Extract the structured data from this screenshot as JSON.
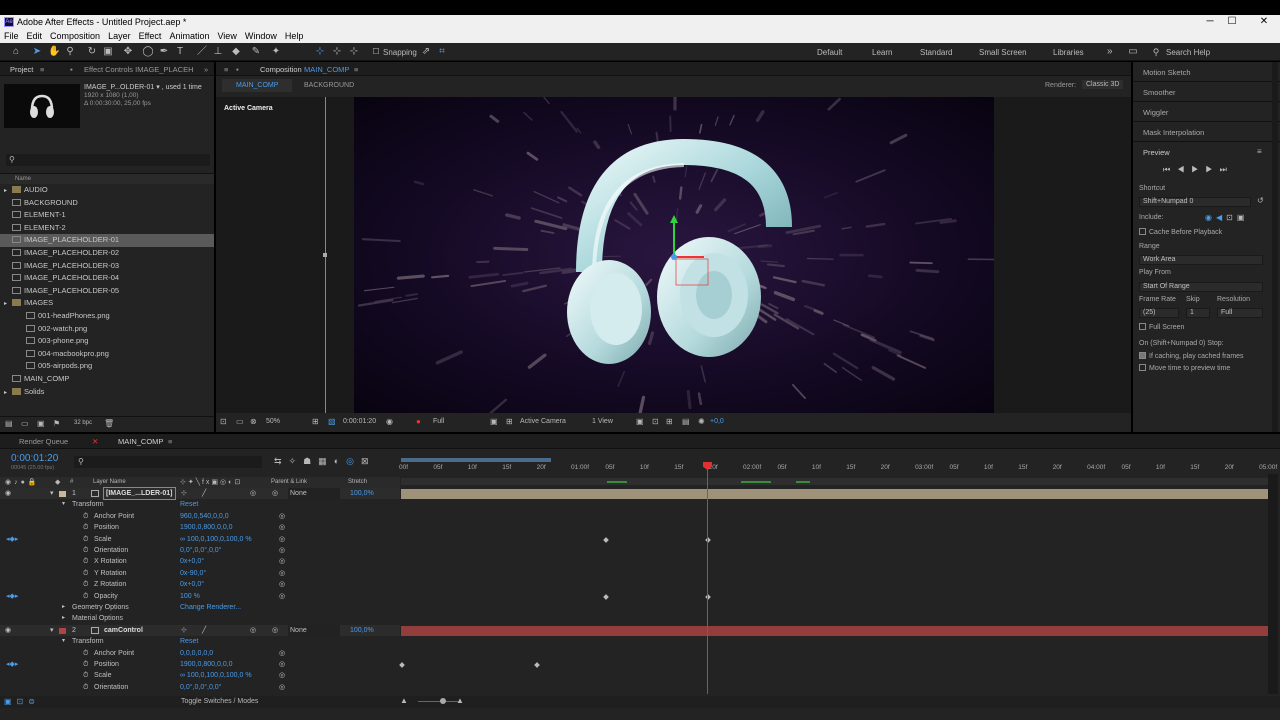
{
  "window": {
    "title": "Adobe After Effects - Untitled Project.aep *",
    "logo_text": "Ae",
    "controls": [
      "─",
      "☐",
      "✕"
    ]
  },
  "menu": [
    "File",
    "Edit",
    "Composition",
    "Layer",
    "Effect",
    "Animation",
    "View",
    "Window",
    "Help"
  ],
  "toolbar": {
    "snapping": "Snapping",
    "workspaces": [
      "Default",
      "Learn",
      "Standard",
      "Small Screen",
      "Libraries"
    ],
    "more": "»",
    "search_placeholder": "Search Help"
  },
  "project_panel": {
    "tab_project": "Project",
    "tab_effect_controls": "Effect Controls IMAGE_PLACEH",
    "selected_name": "IMAGE_P...OLDER-01 ▾ , used 1 time",
    "selected_size": "1920 x 1080 (1,00)",
    "selected_duration": "Δ 0:00:30:00, 25,00 fps",
    "search_placeholder": "",
    "column_name": "Name",
    "items": [
      {
        "name": "AUDIO",
        "type": "folder",
        "indent": 0
      },
      {
        "name": "BACKGROUND",
        "type": "comp",
        "indent": 0
      },
      {
        "name": "ELEMENT-1",
        "type": "comp",
        "indent": 0
      },
      {
        "name": "ELEMENT-2",
        "type": "comp",
        "indent": 0
      },
      {
        "name": "IMAGE_PLACEHOLDER-01",
        "type": "comp",
        "indent": 0,
        "selected": true
      },
      {
        "name": "IMAGE_PLACEHOLDER-02",
        "type": "comp",
        "indent": 0
      },
      {
        "name": "IMAGE_PLACEHOLDER-03",
        "type": "comp",
        "indent": 0
      },
      {
        "name": "IMAGE_PLACEHOLDER-04",
        "type": "comp",
        "indent": 0
      },
      {
        "name": "IMAGE_PLACEHOLDER-05",
        "type": "comp",
        "indent": 0
      },
      {
        "name": "IMAGES",
        "type": "folder",
        "indent": 0
      },
      {
        "name": "001-headPhones.png",
        "type": "file",
        "indent": 1
      },
      {
        "name": "002-watch.png",
        "type": "file",
        "indent": 1
      },
      {
        "name": "003-phone.png",
        "type": "file",
        "indent": 1
      },
      {
        "name": "004-macbookpro.png",
        "type": "file",
        "indent": 1
      },
      {
        "name": "005-airpods.png",
        "type": "file",
        "indent": 1
      },
      {
        "name": "MAIN_COMP",
        "type": "comp",
        "indent": 0
      },
      {
        "name": "Solids",
        "type": "folder",
        "indent": 0
      }
    ],
    "bpc": "32 bpc"
  },
  "composition_panel": {
    "tab_label": "Composition",
    "tab_comp": "MAIN_COMP",
    "crumb_main": "MAIN_COMP",
    "crumb_bg": "BACKGROUND",
    "renderer_label": "Renderer:",
    "renderer_value": "Classic 3D",
    "active_camera_label": "Active Camera",
    "zoom": "50%",
    "timecode": "0:00:01:20",
    "resolution": "Full",
    "camera": "Active Camera",
    "views": "1 View",
    "exposure": "+0,0"
  },
  "right_panel": {
    "items": [
      "Motion Sketch",
      "Smoother",
      "Wiggler",
      "Mask Interpolation"
    ],
    "preview_title": "Preview",
    "shortcut_label": "Shortcut",
    "shortcut_value": "Shift+Numpad 0",
    "include_label": "Include:",
    "cache_before": "Cache Before Playback",
    "range_label": "Range",
    "range_value": "Work Area",
    "play_from_label": "Play From",
    "play_from_value": "Start Of Range",
    "frame_rate_label": "Frame Rate",
    "skip_label": "Skip",
    "resolution_label": "Resolution",
    "frame_rate_value": "(25)",
    "skip_value": "1",
    "resolution_value": "Full",
    "full_screen": "Full Screen",
    "stop_label": "On (Shift+Numpad 0) Stop:",
    "if_caching": "If caching, play cached frames",
    "move_time": "Move time to preview time"
  },
  "timeline": {
    "tab_render_queue": "Render Queue",
    "tab_main": "MAIN_COMP",
    "current_time": "0:00:01:20",
    "frame_info": "00045 (25.00 fps)",
    "col_layer_name": "Layer Name",
    "col_parent": "Parent & Link",
    "col_stretch": "Stretch",
    "ruler": [
      "00f",
      "05f",
      "10f",
      "15f",
      "20f",
      "01:00f",
      "05f",
      "10f",
      "15f",
      "20f",
      "02:00f",
      "05f",
      "10f",
      "15f",
      "20f",
      "03:00f",
      "05f",
      "10f",
      "15f",
      "20f",
      "04:00f",
      "05f",
      "10f",
      "15f",
      "20f",
      "05:00f"
    ],
    "layers": [
      {
        "num": "1",
        "name": "[IMAGE_...LDER-01]",
        "parent": "None",
        "stretch": "100,0%",
        "color": "#c8b89a"
      },
      {
        "num": "2",
        "name": "camControl",
        "parent": "None",
        "stretch": "100,0%",
        "color": "#b04444"
      }
    ],
    "props": [
      {
        "label": "Transform",
        "value": "Reset",
        "level": 1
      },
      {
        "label": "Anchor Point",
        "value": "960,0,540,0,0,0",
        "level": 2
      },
      {
        "label": "Position",
        "value": "1900,0,800,0,0,0",
        "level": 2
      },
      {
        "label": "Scale",
        "value": "∞ 100,0,100,0,100,0 %",
        "level": 2,
        "kf": true
      },
      {
        "label": "Orientation",
        "value": "0,0°,0,0°,0,0°",
        "level": 2
      },
      {
        "label": "X Rotation",
        "value": "0x+0,0°",
        "level": 2
      },
      {
        "label": "Y Rotation",
        "value": "0x-90,0°",
        "level": 2
      },
      {
        "label": "Z Rotation",
        "value": "0x+0,0°",
        "level": 2
      },
      {
        "label": "Opacity",
        "value": "100 %",
        "level": 2,
        "kf": true
      },
      {
        "label": "Geometry Options",
        "value": "Change Renderer...",
        "level": 1
      },
      {
        "label": "Material Options",
        "value": "",
        "level": 1
      }
    ],
    "props2": [
      {
        "label": "Transform",
        "value": "Reset",
        "level": 1
      },
      {
        "label": "Anchor Point",
        "value": "0,0,0,0,0,0",
        "level": 2
      },
      {
        "label": "Position",
        "value": "1900,0,800,0,0,0",
        "level": 2,
        "kf": true
      },
      {
        "label": "Scale",
        "value": "∞ 100,0,100,0,100,0 %",
        "level": 2
      },
      {
        "label": "Orientation",
        "value": "0,0°,0,0°,0,0°",
        "level": 2
      }
    ],
    "toggle_label": "Toggle Switches / Modes"
  },
  "colors": {
    "accent": "#4a9be8",
    "playhead": "#e03030",
    "layer1": "#c8b89a",
    "layer2": "#b04444"
  }
}
